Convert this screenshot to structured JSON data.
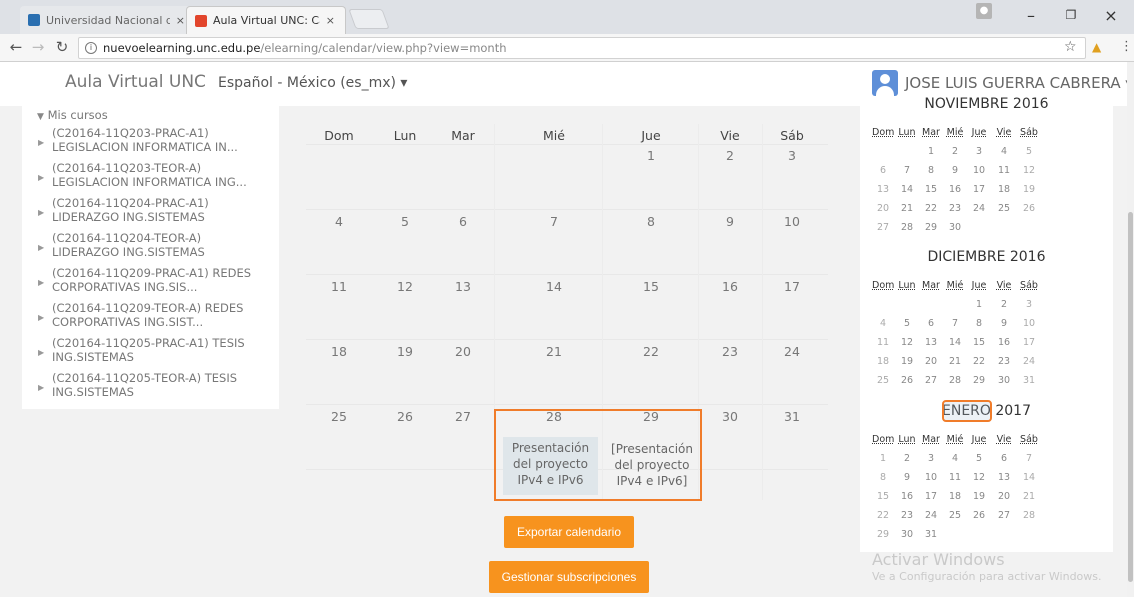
{
  "browser": {
    "tabs": [
      {
        "label": "Universidad Nacional de",
        "active": false
      },
      {
        "label": "Aula Virtual UNC: Calend",
        "active": true
      }
    ],
    "url_host": "nuevoelearning.unc.edu.pe",
    "url_path": "/elearning/calendar/view.php?view=month",
    "close_glyph": "×",
    "minimize_glyph": "–",
    "maximize_glyph": "❐"
  },
  "header": {
    "brand": "Aula Virtual UNC",
    "language": "Español - México (es_mx) ▾",
    "user": "JOSE LUIS GUERRA CABRERA ▾"
  },
  "sidebar": {
    "title": "Mis cursos",
    "courses": [
      {
        "line1": "(C20164-11Q203-PRAC-A1)",
        "line2": "LEGISLACION INFORMATICA IN..."
      },
      {
        "line1": "(C20164-11Q203-TEOR-A)",
        "line2": "LEGISLACION INFORMATICA ING..."
      },
      {
        "line1": "(C20164-11Q204-PRAC-A1)",
        "line2": "LIDERAZGO ING.SISTEMAS"
      },
      {
        "line1": "(C20164-11Q204-TEOR-A)",
        "line2": "LIDERAZGO ING.SISTEMAS"
      },
      {
        "line1": "(C20164-11Q209-PRAC-A1) REDES",
        "line2": "CORPORATIVAS ING.SIS..."
      },
      {
        "line1": "(C20164-11Q209-TEOR-A) REDES",
        "line2": "CORPORATIVAS ING.SIST..."
      },
      {
        "line1": "(C20164-11Q205-PRAC-A1) TESIS",
        "line2": "ING.SISTEMAS"
      },
      {
        "line1": "(C20164-11Q205-TEOR-A) TESIS",
        "line2": "ING.SISTEMAS"
      }
    ]
  },
  "calendar": {
    "weekdays": [
      "Dom",
      "Lun",
      "Mar",
      "Mié",
      "Jue",
      "Vie",
      "Sáb"
    ],
    "weeks": [
      [
        "",
        "",
        "",
        "",
        "1",
        "2",
        "3"
      ],
      [
        "4",
        "5",
        "6",
        "7",
        "8",
        "9",
        "10"
      ],
      [
        "11",
        "12",
        "13",
        "14",
        "15",
        "16",
        "17"
      ],
      [
        "18",
        "19",
        "20",
        "21",
        "22",
        "23",
        "24"
      ],
      [
        "25",
        "26",
        "27",
        "28",
        "29",
        "30",
        "31"
      ]
    ],
    "events": [
      {
        "day": "28",
        "text": "Presentación del proyecto IPv4 e IPv6"
      },
      {
        "day": "29",
        "text": "[Presentación del proyecto IPv4 e IPv6]"
      }
    ],
    "export_label": "Exportar calendario",
    "manage_label": "Gestionar subscripciones"
  },
  "minicals": {
    "weekdays": [
      "Dom",
      "Lun",
      "Mar",
      "Mié",
      "Jue",
      "Vie",
      "Sáb"
    ],
    "months": [
      {
        "title": "NOVIEMBRE 2016",
        "weeks": [
          [
            "",
            "",
            "1",
            "2",
            "3",
            "4",
            "5"
          ],
          [
            "6",
            "7",
            "8",
            "9",
            "10",
            "11",
            "12"
          ],
          [
            "13",
            "14",
            "15",
            "16",
            "17",
            "18",
            "19"
          ],
          [
            "20",
            "21",
            "22",
            "23",
            "24",
            "25",
            "26"
          ],
          [
            "27",
            "28",
            "29",
            "30",
            "",
            "",
            ""
          ]
        ]
      },
      {
        "title": "DICIEMBRE 2016",
        "weeks": [
          [
            "",
            "",
            "",
            "",
            "1",
            "2",
            "3"
          ],
          [
            "4",
            "5",
            "6",
            "7",
            "8",
            "9",
            "10"
          ],
          [
            "11",
            "12",
            "13",
            "14",
            "15",
            "16",
            "17"
          ],
          [
            "18",
            "19",
            "20",
            "21",
            "22",
            "23",
            "24"
          ],
          [
            "25",
            "26",
            "27",
            "28",
            "29",
            "30",
            "31"
          ]
        ]
      },
      {
        "title": "ENERO 2017",
        "weeks": [
          [
            "1",
            "2",
            "3",
            "4",
            "5",
            "6",
            "7"
          ],
          [
            "8",
            "9",
            "10",
            "11",
            "12",
            "13",
            "14"
          ],
          [
            "15",
            "16",
            "17",
            "18",
            "19",
            "20",
            "21"
          ],
          [
            "22",
            "23",
            "24",
            "25",
            "26",
            "27",
            "28"
          ],
          [
            "29",
            "30",
            "31",
            "",
            "",
            "",
            ""
          ]
        ]
      }
    ]
  },
  "watermark": {
    "line1": "Activar Windows",
    "line2": "Ve a Configuración para activar Windows."
  },
  "colors": {
    "accent": "#f7931e",
    "highlight": "#f07c2a"
  }
}
